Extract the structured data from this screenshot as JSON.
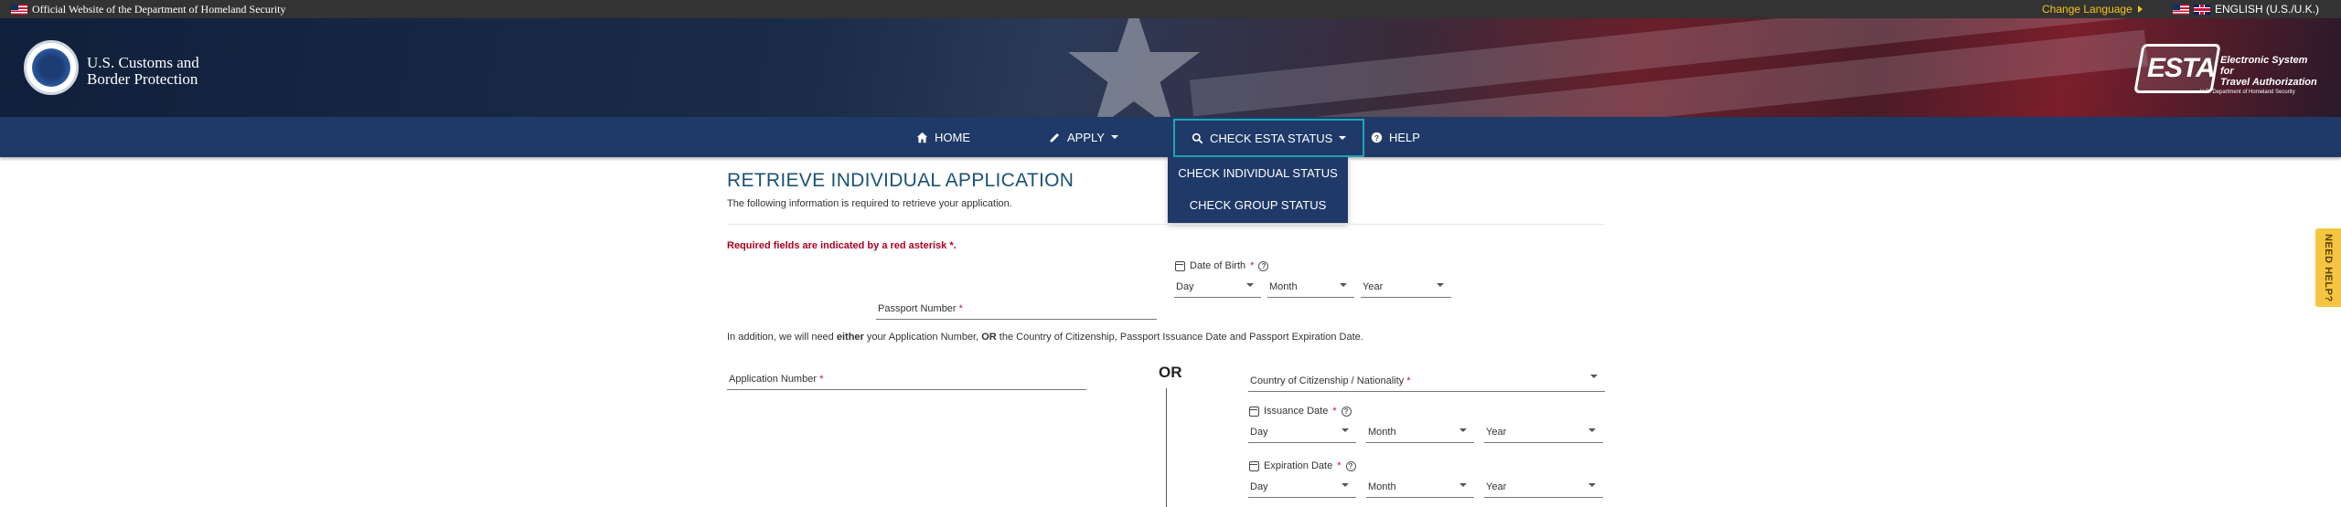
{
  "topbar": {
    "official": "Official Website of the Department of Homeland Security",
    "change_language": "Change Language",
    "language": "ENGLISH (U.S./U.K.)"
  },
  "header": {
    "agency_line1": "U.S. Customs and",
    "agency_line2": "Border Protection",
    "esta_logo": "ESTA",
    "esta_sub_line1": "Electronic System for",
    "esta_sub_line2": "Travel Authorization",
    "esta_dhs": "U.S. Department of Homeland Security"
  },
  "nav": {
    "home": "HOME",
    "apply": "APPLY",
    "check_status": "CHECK ESTA STATUS",
    "help": "HELP"
  },
  "dropdown": {
    "individual": "CHECK INDIVIDUAL STATUS",
    "group": "CHECK GROUP STATUS"
  },
  "form": {
    "title": "RETRIEVE INDIVIDUAL APPLICATION",
    "subtitle": "The following information is required to retrieve your application.",
    "required_note": "Required fields are indicated by a red asterisk ",
    "required_star": "*.",
    "passport_number": "Passport Number ",
    "date_of_birth": "Date of Birth ",
    "star": "*",
    "day": "Day",
    "month": "Month",
    "year": "Year",
    "info_pre": "In addition, we will need ",
    "info_either": "either",
    "info_mid": " your Application Number, ",
    "info_or": "OR",
    "info_post": " the Country of Citizenship, Passport Issuance Date and Passport Expiration Date.",
    "application_number": "Application Number ",
    "or_divider": "OR",
    "country": "Country of Citizenship / Nationality ",
    "issuance_date": "Issuance Date ",
    "expiration_date": "Expiration Date "
  },
  "need_help": "NEED HELP?",
  "colors": {
    "nav": "#1f3a68",
    "accent": "#21a3b8",
    "title": "#1a5276",
    "required": "#b00020",
    "need_help": "#f5c542"
  }
}
